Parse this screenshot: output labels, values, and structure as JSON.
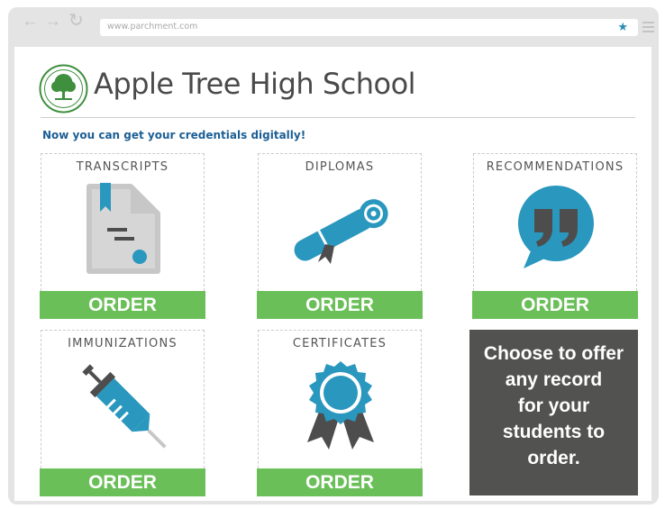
{
  "browser": {
    "url": "www.parchment.com"
  },
  "header": {
    "school_name": "Apple Tree High School",
    "tagline": "Now you can get your credentials digitally!"
  },
  "cards": [
    {
      "title": "TRANSCRIPTS",
      "icon": "transcript-icon",
      "order_label": "ORDER"
    },
    {
      "title": "DIPLOMAS",
      "icon": "diploma-icon",
      "order_label": "ORDER"
    },
    {
      "title": "RECOMMENDATIONS",
      "icon": "quote-bubble-icon",
      "order_label": "ORDER"
    },
    {
      "title": "IMMUNIZATIONS",
      "icon": "syringe-icon",
      "order_label": "ORDER"
    },
    {
      "title": "CERTIFICATES",
      "icon": "award-ribbon-icon",
      "order_label": "ORDER"
    }
  ],
  "promo": {
    "lines": [
      "Choose to offer",
      "any record",
      "for your",
      "students to",
      "order."
    ]
  },
  "colors": {
    "order_green": "#6abf58",
    "icon_blue": "#2a97be",
    "icon_dark": "#4d4d4d",
    "tagline_blue": "#1c5f95",
    "promo_bg": "#525250"
  }
}
